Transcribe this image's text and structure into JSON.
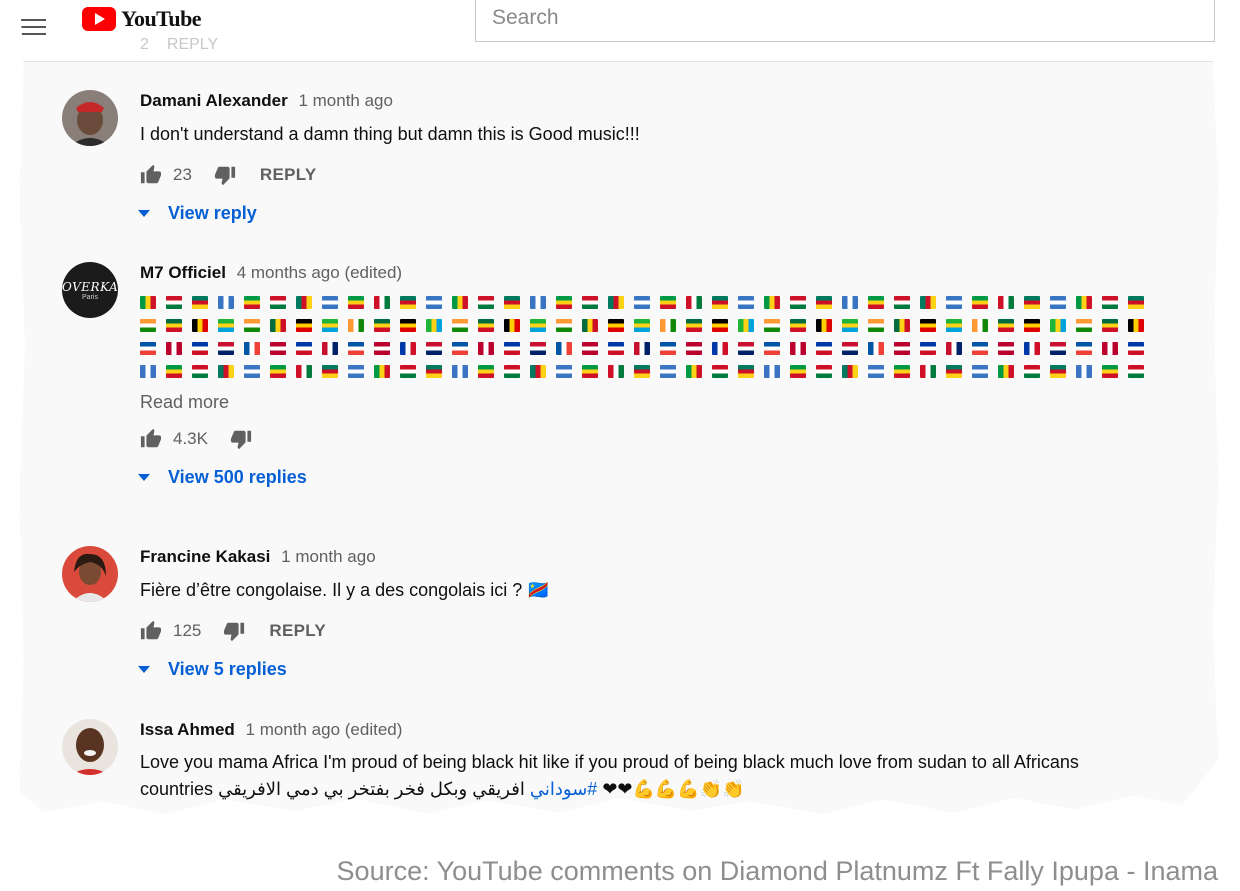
{
  "header": {
    "logo_text": "YouTube",
    "search_placeholder": "Search",
    "prev_likes": "2",
    "prev_reply": "REPLY"
  },
  "comments": [
    {
      "author": "Damani Alexander",
      "timestamp": "1 month ago",
      "text": "I don't understand a damn thing but damn this is Good music!!!",
      "likes": "23",
      "reply_label": "REPLY",
      "view_replies": "View reply"
    },
    {
      "author": "M7 Officiel",
      "timestamp": "4 months ago (edited)",
      "avatar_text": "OVERKA",
      "avatar_subtext": "Paris",
      "flag_rows": [
        39,
        39,
        39,
        39
      ],
      "read_more": "Read more",
      "likes": "4.3K",
      "view_replies": "View 500 replies"
    },
    {
      "author": "Francine Kakasi",
      "timestamp": "1 month ago",
      "text": "Fière d’être congolaise. Il y a des congolais ici ? 🇨🇩",
      "likes": "125",
      "reply_label": "REPLY",
      "view_replies": "View 5 replies"
    },
    {
      "author": "Issa Ahmed",
      "timestamp": "1 month ago (edited)",
      "text_line1": "Love you mama Africa I'm proud of being black hit like if you proud of being black much love from sudan to all Africans",
      "text_line2_start": "countries",
      "hashtag": "#سوداني",
      "arabic": "افريقي وبكل فخر بفتخر بي دمي الافريقي",
      "emoji": "❤❤💪💪💪👏👏"
    }
  ],
  "source": "Source: YouTube comments on Diamond Platnumz Ft Fally Ipupa - Inama",
  "colors": {
    "link_blue": "#065fd4",
    "meta_gray": "#606060",
    "brand_red": "#ff0000",
    "paper_bg": "#f9f9f9"
  }
}
